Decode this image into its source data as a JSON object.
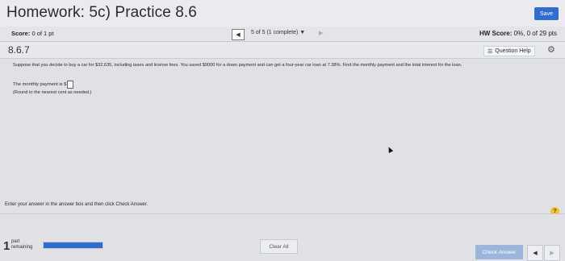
{
  "header": {
    "title": "Homework: 5c) Practice 8.6",
    "save_label": "Save"
  },
  "scorebar": {
    "score_label": "Score:",
    "score_value": "0 of 1 pt",
    "nav_prev_icon": "triangle-left",
    "nav_status": "5 of 5 (1 complete) ▼",
    "nav_next_icon": "triangle-right",
    "hw_score_label": "HW Score:",
    "hw_score_value": "0%, 0 of 29 pts"
  },
  "question_bar": {
    "number": "8.6.7",
    "help_label": "Question Help",
    "help_icon": "list-icon",
    "settings_icon": "gear-icon"
  },
  "question": {
    "text": "Suppose that you decide to buy a car for $32,635, including taxes and license fees. You saved $9000 for a down payment and can get a four-year car loan at 7.38%. Find the monthly payment and the total interest for the loan.",
    "answer_prefix": "The monthly payment is $",
    "answer_value": "",
    "round_note": "(Round to the nearest cent as needed.)"
  },
  "footer": {
    "instructions": "Enter your answer in the answer box and then click Check Answer.",
    "part_number": "1",
    "part_label_line1": "part",
    "part_label_line2": "remaining",
    "progress_fraction": 1.0,
    "clear_label": "Clear All",
    "check_label": "Check Answer",
    "help_circle": "?"
  },
  "colors": {
    "accent": "#2f6dd0",
    "check_button": "#9cb5dc",
    "help_circle": "#f2c230"
  }
}
